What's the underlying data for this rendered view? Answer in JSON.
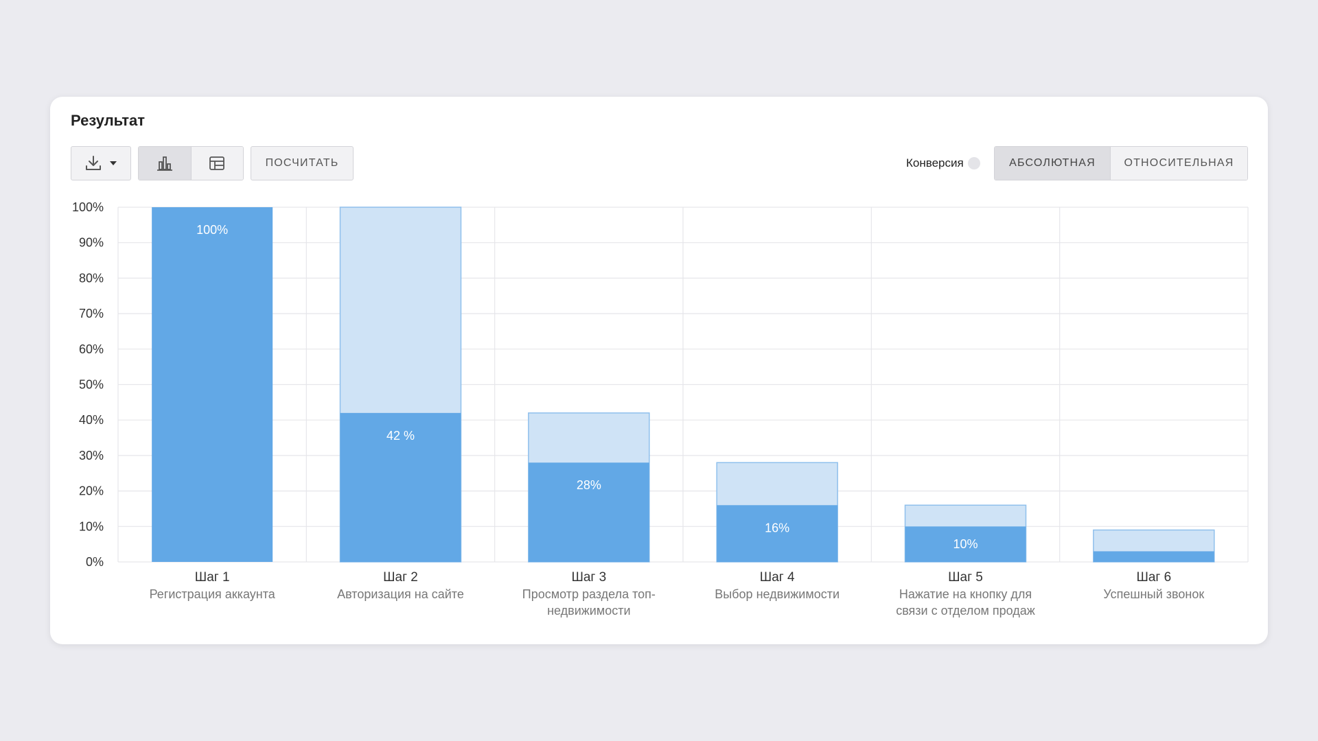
{
  "header": {
    "title": "Результат"
  },
  "toolbar": {
    "download_icon": "download-icon",
    "dropdown_icon": "caret-down-icon",
    "chart_view_icon": "bar-chart-icon",
    "table_view_icon": "table-icon",
    "count_label": "ПОСЧИТАТЬ"
  },
  "conversion": {
    "label": "Конверсия",
    "help_icon": "help-icon",
    "options": [
      "АБСОЛЮТНАЯ",
      "ОТНОСИТЕЛЬНАЯ"
    ],
    "selected": "АБСОЛЮТНАЯ"
  },
  "colors": {
    "bar_solid": "#62a8e6",
    "bar_light": "#cfe3f6",
    "bar_light_border": "#8fc0ec"
  },
  "chart_data": {
    "type": "bar",
    "ylim": [
      0,
      100
    ],
    "yticks": [
      "0%",
      "10%",
      "20%",
      "30%",
      "40%",
      "50%",
      "60%",
      "70%",
      "80%",
      "90%",
      "100%"
    ],
    "categories": [
      {
        "step": "Шаг 1",
        "name": [
          "Регистрация аккаунта"
        ]
      },
      {
        "step": "Шаг 2",
        "name": [
          "Авторизация на сайте"
        ]
      },
      {
        "step": "Шаг 3",
        "name": [
          "Просмотр раздела топ-",
          "недвижимости"
        ]
      },
      {
        "step": "Шаг 4",
        "name": [
          "Выбор недвижимости"
        ]
      },
      {
        "step": "Шаг 5",
        "name": [
          "Нажатие на кнопку для",
          "связи с отделом продаж"
        ]
      },
      {
        "step": "Шаг 6",
        "name": [
          "Успешный звонок"
        ]
      }
    ],
    "series": [
      {
        "values": [
          100,
          42,
          28,
          16,
          10,
          3
        ]
      },
      {
        "values": [
          null,
          100,
          42,
          28,
          16,
          9
        ]
      }
    ],
    "data_labels": [
      "100%",
      "42 %",
      "28%",
      "16%",
      "10%",
      ""
    ],
    "grid": true
  }
}
